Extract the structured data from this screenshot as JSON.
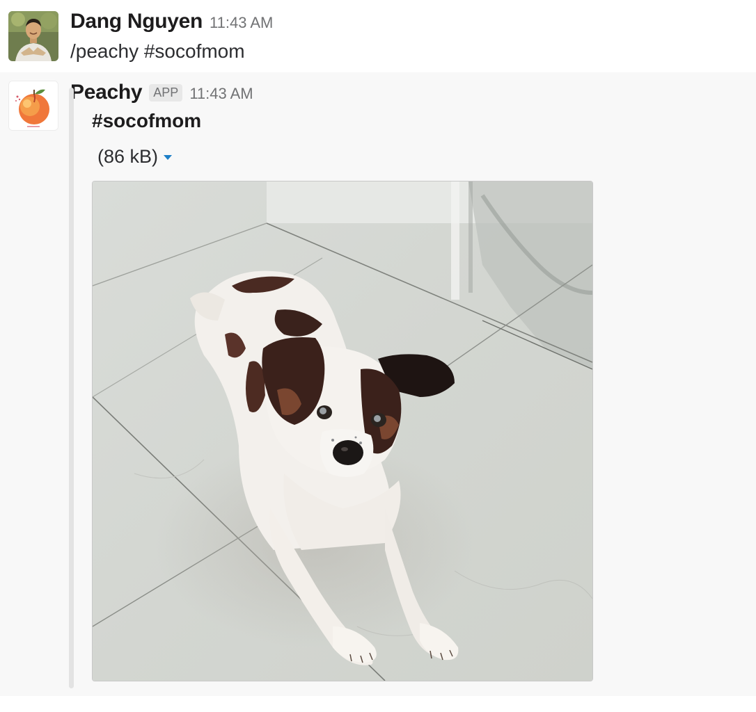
{
  "messages": {
    "user": {
      "sender": "Dang Nguyen",
      "time": "11:43 AM",
      "text": "/peachy #socofmom",
      "avatar_icon": "user-avatar"
    },
    "bot": {
      "sender": "Peachy",
      "badge": "APP",
      "time": "11:43 AM",
      "avatar_icon": "peach-logo",
      "attachment": {
        "title": "#socofmom",
        "file_size": "(86 kB)",
        "dropdown_icon": "caret-down-icon",
        "image_subject": "dog-photo"
      }
    }
  },
  "colors": {
    "link_blue": "#1d7fc7",
    "bot_background": "#f8f8f8",
    "attachment_bar": "#e3e3e3"
  }
}
